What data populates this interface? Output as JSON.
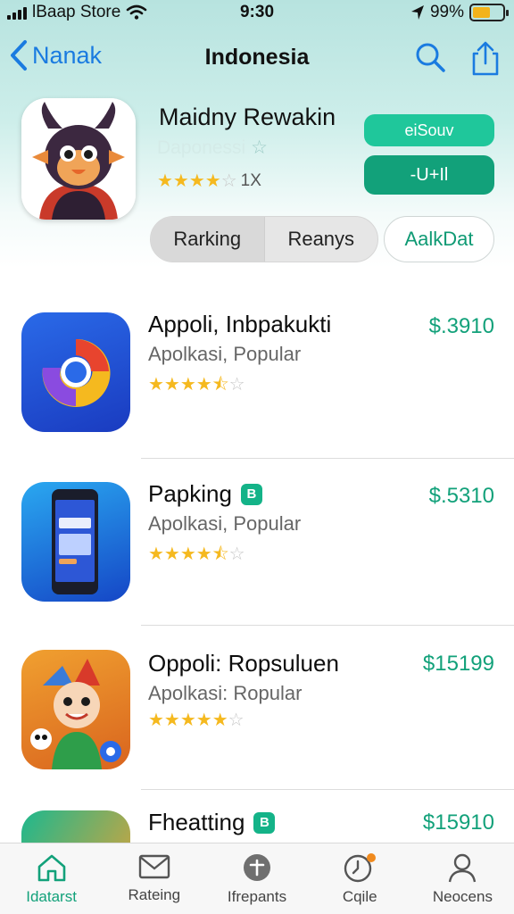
{
  "status_bar": {
    "carrier": "lBaap Store",
    "time": "9:30",
    "battery": "99%"
  },
  "nav": {
    "back_label": "Nanak",
    "title": "Indonesia"
  },
  "hero": {
    "name": "Maidny Rewakin",
    "subtitle": "Daponessi",
    "rating_stars": 4,
    "rating_count": "1X",
    "button_primary": "eiSouv",
    "button_secondary": "-U+Il"
  },
  "segmented": {
    "items": [
      "Rarking",
      "Reanys"
    ],
    "active_index": 0,
    "aux_button": "AalkDat"
  },
  "apps": [
    {
      "name": "Appoli, Inbpakukti",
      "category": "Apolkasi, Popular",
      "rating": 4.5,
      "price": "$.3910",
      "badge": ""
    },
    {
      "name": "Papking",
      "category": "Apolkasi, Popular",
      "rating": 4.5,
      "price": "$.5310",
      "badge": "B"
    },
    {
      "name": "Oppoli: Ropsuluen",
      "category": "Apolkasi: Ropular",
      "rating": 5,
      "price": "$15199",
      "badge": ""
    },
    {
      "name": "Fheatting",
      "category": "",
      "rating": 0,
      "price": "$15910",
      "badge": "B"
    }
  ],
  "tabs": [
    {
      "label": "Idatarst",
      "icon": "home-icon"
    },
    {
      "label": "Rateing",
      "icon": "mail-icon"
    },
    {
      "label": "Ifrepants",
      "icon": "plus-circle-icon"
    },
    {
      "label": "Cqile",
      "icon": "clock-icon"
    },
    {
      "label": "Neocens",
      "icon": "person-icon"
    }
  ],
  "active_tab": 0,
  "colors": {
    "accent": "#12a17a",
    "accent_light": "#1fc79b",
    "nav_blue": "#1a7be0",
    "star": "#f5b91f"
  }
}
